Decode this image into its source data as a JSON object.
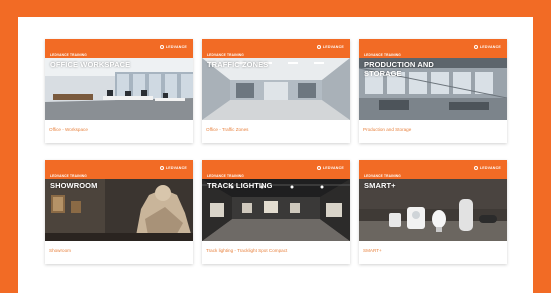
{
  "brand": "LEDVANCE",
  "cards": [
    {
      "subtitle": "LEDVANCE TRAINING",
      "title": "OFFICE WORKSPACE",
      "caption": "Office - Workspace"
    },
    {
      "subtitle": "LEDVANCE TRAINING",
      "title": "TRAFFIC ZONES",
      "caption": "Office - Traffic Zones"
    },
    {
      "subtitle": "LEDVANCE TRAINING",
      "title": "PRODUCTION AND STORAGE",
      "caption": "Production and Storage"
    },
    {
      "subtitle": "LEDVANCE TRAINING",
      "title": "SHOWROOM",
      "caption": "Showroom"
    },
    {
      "subtitle": "LEDVANCE TRAINING",
      "title": "TRACK LIGHTING",
      "caption": "Track lighting - Tracklight Spot Compact"
    },
    {
      "subtitle": "LEDVANCE TRAINING",
      "title": "SMART+",
      "caption": "SMART+"
    }
  ],
  "colors": {
    "accent": "#f26b25",
    "caption": "#e8823f"
  }
}
